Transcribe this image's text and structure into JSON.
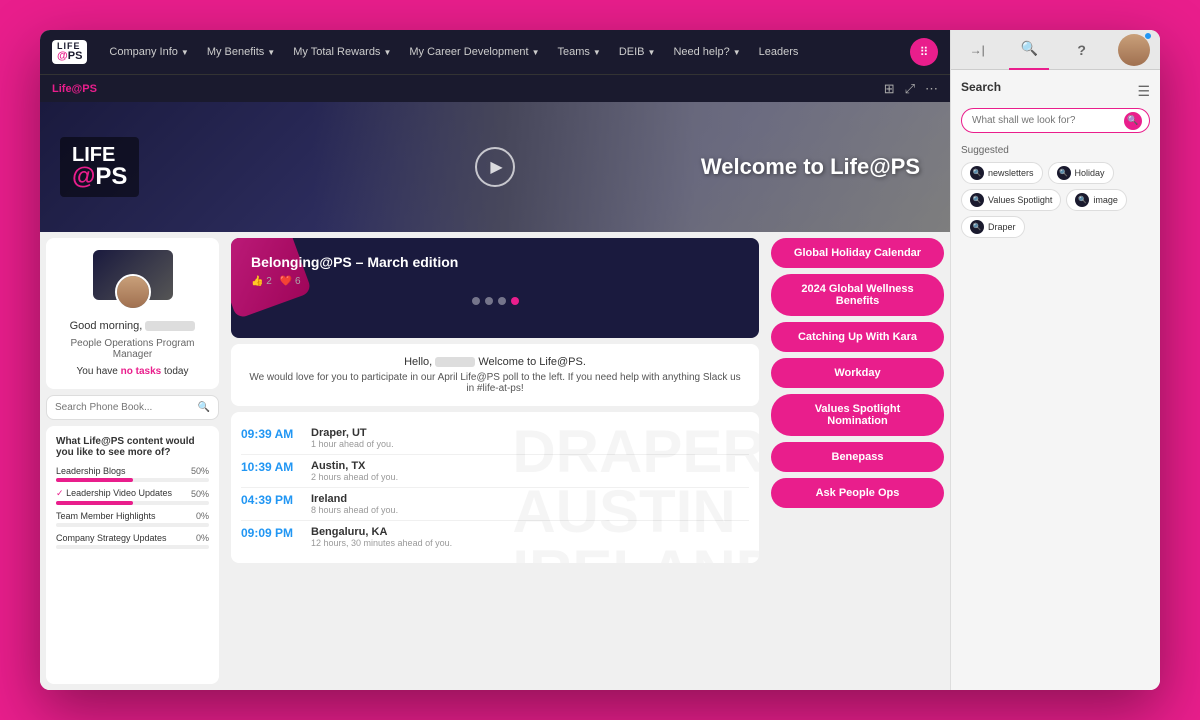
{
  "navbar": {
    "logo_life": "LIFE",
    "logo_at": "@",
    "logo_ps": "PS",
    "items": [
      {
        "label": "Company Info",
        "has_chevron": true
      },
      {
        "label": "My Benefits",
        "has_chevron": true
      },
      {
        "label": "My Total Rewards",
        "has_chevron": true
      },
      {
        "label": "My Career Development",
        "has_chevron": true
      },
      {
        "label": "Teams",
        "has_chevron": true
      },
      {
        "label": "DEIB",
        "has_chevron": true
      },
      {
        "label": "Need help?",
        "has_chevron": true
      },
      {
        "label": "Leaders"
      }
    ]
  },
  "subnav": {
    "brand": "Life@PS",
    "icons": [
      "grid",
      "share",
      "more"
    ]
  },
  "hero": {
    "title": "Welcome to Life@PS",
    "logo_life": "LIFE",
    "logo_at": "@",
    "logo_ps": "PS"
  },
  "profile": {
    "greeting": "Good morning,",
    "title": "People Operations Program Manager",
    "tasks_prefix": "You have",
    "tasks_link": "no tasks",
    "tasks_suffix": "today"
  },
  "phonebook": {
    "placeholder": "Search Phone Book..."
  },
  "poll": {
    "question": "What Life@PS content would you like to see more of?",
    "items": [
      {
        "label": "Leadership Blogs",
        "pct": 50,
        "checked": false
      },
      {
        "label": "Leadership Video Updates",
        "pct": 50,
        "checked": true
      },
      {
        "label": "Team Member Highlights",
        "pct": 0,
        "checked": false
      },
      {
        "label": "Company Strategy Updates",
        "pct": 0,
        "checked": false
      }
    ]
  },
  "belonging": {
    "title": "Belonging@PS – March edition",
    "reaction_count": "2",
    "heart_count": "6",
    "dots": [
      false,
      false,
      false,
      true
    ]
  },
  "hello": {
    "text1": "Hello,",
    "text2": "Welcome to Life@PS.",
    "desc": "We would love for you to participate in our April Life@PS poll to the left. If you need help with anything Slack us in #life-at-ps!"
  },
  "timezones": [
    {
      "time": "09:39 AM",
      "location": "Draper, UT",
      "offset": "1 hour ahead of you."
    },
    {
      "time": "10:39 AM",
      "location": "Austin, TX",
      "offset": "2 hours ahead of you."
    },
    {
      "time": "04:39 PM",
      "location": "Ireland",
      "offset": "8 hours ahead of you."
    },
    {
      "time": "09:09 PM",
      "location": "Bengaluru, KA",
      "offset": "12 hours, 30 minutes ahead of you."
    }
  ],
  "tz_bg_text": "DRAPER\nAUSTIN\nIRELAND\nBU",
  "quick_links": [
    "Global Holiday Calendar",
    "2024 Global Wellness Benefits",
    "Catching Up With Kara",
    "Workday",
    "Values Spotlight Nomination",
    "Benepass",
    "Ask People Ops"
  ],
  "right_panel": {
    "tabs": [
      {
        "icon": "→|",
        "label": "collapse"
      },
      {
        "icon": "🔍",
        "label": "search",
        "active": true
      },
      {
        "icon": "?",
        "label": "help"
      }
    ],
    "search": {
      "title": "Search",
      "placeholder": "What shall we look for?",
      "suggested_label": "Suggested",
      "chips": [
        {
          "label": "newsletters"
        },
        {
          "label": "Holiday"
        },
        {
          "label": "Values Spotlight"
        },
        {
          "label": "image"
        },
        {
          "label": "Draper"
        }
      ]
    }
  }
}
